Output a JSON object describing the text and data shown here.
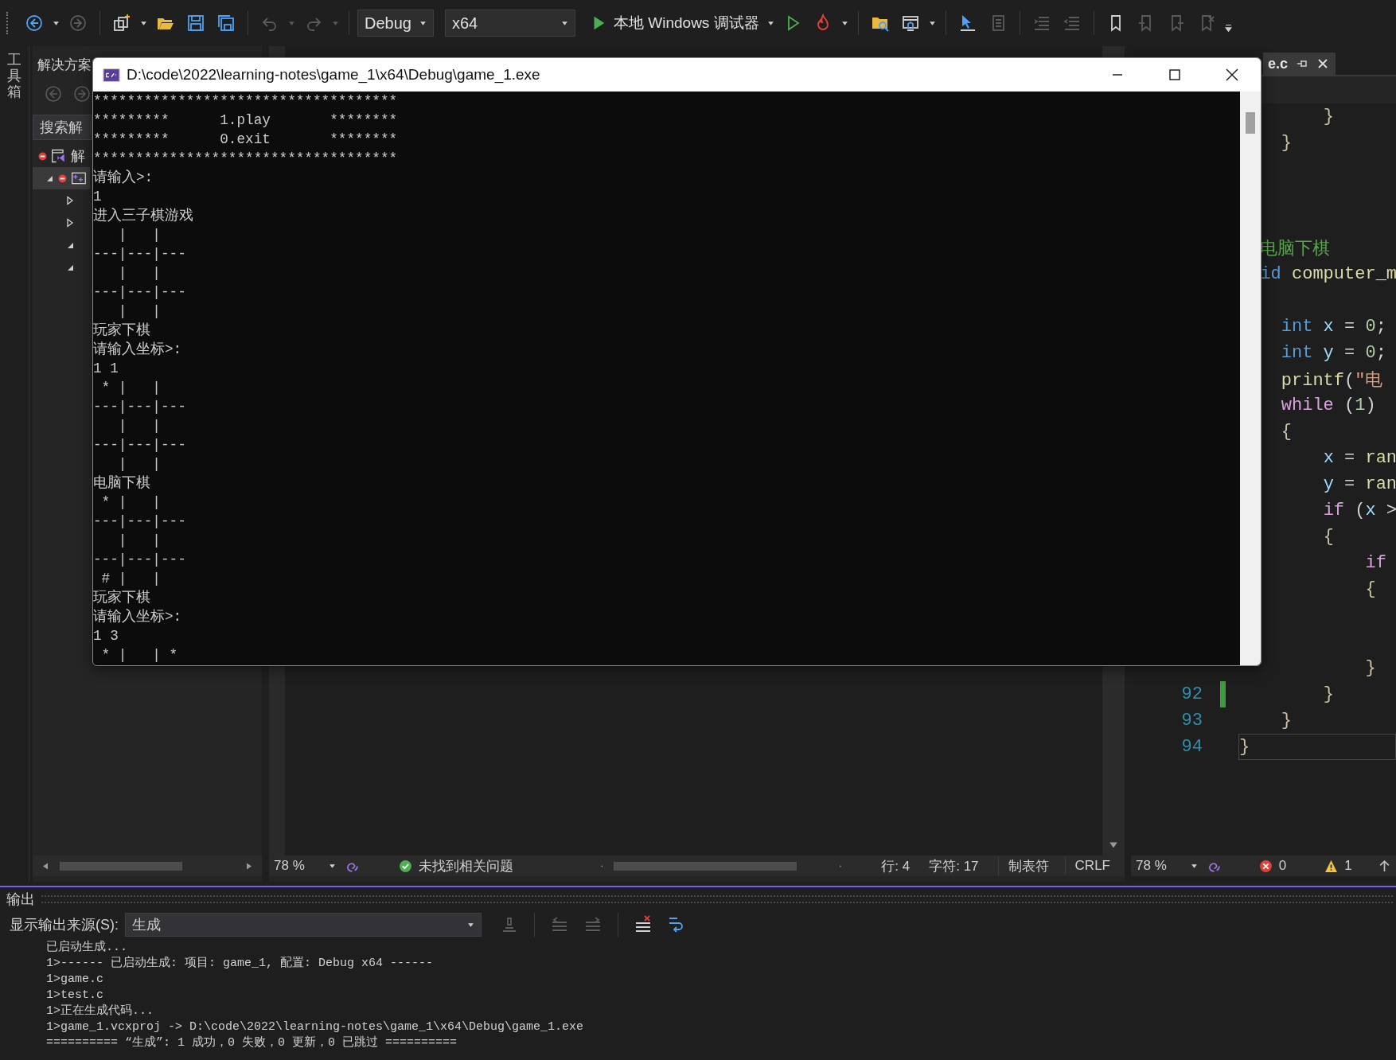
{
  "toolbar": {
    "left_groups": [
      [
        {
          "disabled": false,
          "dropdown": true
        },
        {
          "disabled": true,
          "dropdown": false
        }
      ],
      [
        {
          "disabled": false,
          "dropdown": true
        },
        {
          "disabled": false,
          "dropdown": false
        },
        {
          "disabled": false,
          "dropdown": false
        },
        {
          "disabled": false,
          "dropdown": false
        }
      ],
      [
        {
          "disabled": true,
          "dropdown": true
        },
        {
          "disabled": true,
          "dropdown": true
        }
      ]
    ],
    "configuration": "Debug",
    "platform": "x64",
    "run_label": "本地 Windows 调试器",
    "tool_groups": [
      [
        {
          "disabled": false,
          "dropdown": false
        },
        {
          "disabled": false,
          "dropdown": true
        }
      ],
      [
        {
          "disabled": false,
          "dropdown": false
        },
        {
          "disabled": false,
          "dropdown": true
        }
      ],
      [
        {
          "disabled": false,
          "dropdown": false
        },
        {
          "disabled": true,
          "dropdown": false
        }
      ],
      [
        {
          "disabled": true,
          "dropdown": false
        },
        {
          "disabled": true,
          "dropdown": false
        }
      ],
      [
        {
          "disabled": false,
          "dropdown": false
        },
        {
          "disabled": true,
          "dropdown": false
        },
        {
          "disabled": true,
          "dropdown": false
        },
        {
          "disabled": true,
          "dropdown": false
        }
      ]
    ]
  },
  "toolbox": {
    "label": "工具箱"
  },
  "solution_explorer": {
    "title": "解决方案",
    "search": {
      "placeholder": "搜索解"
    },
    "tree": [
      {
        "kind": "solution",
        "label": "解",
        "selected": false,
        "children": [
          {
            "kind": "project",
            "expanded": true,
            "selected": true,
            "children": [
              {
                "expanded": false,
                "selected": false
              },
              {
                "expanded": false,
                "selected": false
              },
              {
                "expanded": true,
                "selected": false
              },
              {
                "expanded": true,
                "selected": false
              }
            ]
          }
        ]
      }
    ]
  },
  "editor": {
    "zoom": "78 %",
    "issues": "未找到相关问题",
    "line": "行: 4",
    "column": "字符: 17",
    "indent_mode": "制表符",
    "line_ending": "CRLF"
  },
  "code_editor": {
    "tab": {
      "label": "e.c"
    },
    "zoom": "78 %",
    "errors": "0",
    "warnings": "1",
    "rows": [
      {
        "tokens": [
          {
            "t": "        }",
            "kind": "brace"
          }
        ],
        "current": false
      },
      {
        "tokens": [
          {
            "t": "    }",
            "kind": "brace"
          }
        ],
        "current": false
      },
      {
        "current": false
      },
      {
        "current": false
      },
      {
        "current": false
      },
      {
        "tokens": [
          {
            "t": "  电脑下棋",
            "kind": "comment"
          }
        ],
        "current": false
      },
      {
        "tokens": [
          {
            "t": "  id",
            "kind": "keyword"
          },
          {
            "t": " computer_m",
            "kind": "func"
          }
        ],
        "current": false
      },
      {
        "current": false
      },
      {
        "tokens": [
          {
            "t": "    int",
            "kind": "keyword"
          },
          {
            "t": " x",
            "kind": "var"
          },
          {
            "t": " = ",
            "kind": "plain"
          },
          {
            "t": "0",
            "kind": "number"
          },
          {
            "t": ";",
            "kind": "plain"
          }
        ],
        "current": false
      },
      {
        "tokens": [
          {
            "t": "    int",
            "kind": "keyword"
          },
          {
            "t": " y",
            "kind": "var"
          },
          {
            "t": " = ",
            "kind": "plain"
          },
          {
            "t": "0",
            "kind": "number"
          },
          {
            "t": ";",
            "kind": "plain"
          }
        ],
        "current": false
      },
      {
        "tokens": [
          {
            "t": "    printf",
            "kind": "func"
          },
          {
            "t": "(",
            "kind": "plain"
          },
          {
            "t": "\"电",
            "kind": "string"
          }
        ],
        "current": false
      },
      {
        "tokens": [
          {
            "t": "    while",
            "kind": "control"
          },
          {
            "t": " (",
            "kind": "plain"
          },
          {
            "t": "1",
            "kind": "number"
          },
          {
            "t": ")",
            "kind": "plain"
          }
        ],
        "current": false
      },
      {
        "tokens": [
          {
            "t": "    {",
            "kind": "brace"
          }
        ],
        "current": false
      },
      {
        "tokens": [
          {
            "t": "        x",
            "kind": "var"
          },
          {
            "t": " = ",
            "kind": "plain"
          },
          {
            "t": "ran",
            "kind": "func"
          }
        ],
        "current": false
      },
      {
        "tokens": [
          {
            "t": "        y",
            "kind": "var"
          },
          {
            "t": " = ",
            "kind": "plain"
          },
          {
            "t": "ran",
            "kind": "func"
          }
        ],
        "current": false
      },
      {
        "tokens": [
          {
            "t": "        if",
            "kind": "control"
          },
          {
            "t": " (",
            "kind": "plain"
          },
          {
            "t": "x",
            "kind": "var"
          },
          {
            "t": " >",
            "kind": "plain"
          }
        ],
        "current": false
      },
      {
        "tokens": [
          {
            "t": "        {",
            "kind": "brace"
          }
        ],
        "current": false
      },
      {
        "tokens": [
          {
            "t": "            if",
            "kind": "control"
          }
        ],
        "current": false
      },
      {
        "tokens": [
          {
            "t": "            {",
            "kind": "brace"
          }
        ],
        "current": false
      },
      {
        "current": false
      },
      {
        "current": false
      },
      {
        "tokens": [
          {
            "t": "            }",
            "kind": "brace"
          }
        ],
        "current": false
      },
      {
        "number": "92",
        "tokens": [
          {
            "t": "        }",
            "kind": "brace"
          }
        ],
        "modified": true,
        "current": false
      },
      {
        "number": "93",
        "tokens": [
          {
            "t": "    }",
            "kind": "brace"
          }
        ],
        "modified": false,
        "current": false
      },
      {
        "number": "94",
        "tokens": [
          {
            "t": "}",
            "kind": "brace"
          }
        ],
        "modified": false,
        "current": true
      }
    ]
  },
  "console": {
    "title": "D:\\code\\2022\\learning-notes\\game_1\\x64\\Debug\\game_1.exe",
    "lines": [
      "************************************",
      "*********      1.play       ********",
      "*********      0.exit       ********",
      "************************************",
      "请输入>:",
      "1",
      "进入三子棋游戏",
      "   |   |   ",
      "---|---|---",
      "   |   |   ",
      "---|---|---",
      "   |   |   ",
      "玩家下棋",
      "请输入坐标>:",
      "1 1",
      " * |   |   ",
      "---|---|---",
      "   |   |   ",
      "---|---|---",
      "   |   |   ",
      "电脑下棋",
      " * |   |   ",
      "---|---|---",
      "   |   |   ",
      "---|---|---",
      " # |   |   ",
      "玩家下棋",
      "请输入坐标>:",
      "1 3",
      " * |   | * "
    ]
  },
  "output": {
    "title": "输出",
    "source_label": "显示输出来源(S):",
    "source": "生成",
    "tools": [
      {
        "disabled": true
      },
      {
        "disabled": true
      },
      {
        "disabled": true
      },
      {
        "disabled": false
      },
      {
        "disabled": false
      }
    ],
    "lines": [
      "已启动生成...",
      "1>------ 已启动生成: 项目: game_1, 配置: Debug x64 ------",
      "1>game.c",
      "1>test.c",
      "1>正在生成代码...",
      "1>game_1.vcxproj -> D:\\code\\2022\\learning-notes\\game_1\\x64\\Debug\\game_1.exe",
      "========== “生成”: 1 成功，0 失败，0 更新，0 已跳过 =========="
    ]
  }
}
